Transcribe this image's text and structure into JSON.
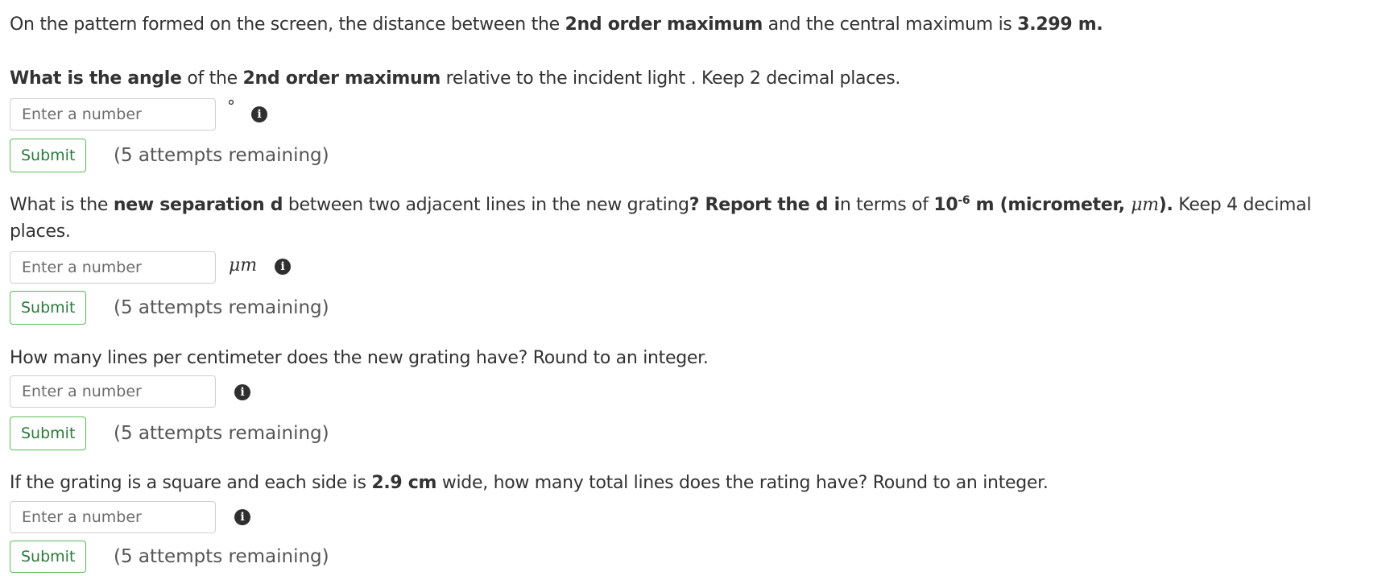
{
  "intro": {
    "t1": "On the pattern formed on the screen, the distance between the ",
    "b1": "2nd order maximum",
    "t2": " and the central maximum is ",
    "b2": "3.299 m."
  },
  "questions": [
    {
      "prompt": {
        "b1": "What is the angle",
        "t1": " of the ",
        "b2": "2nd order maximum",
        "t2": " relative to the incident light . Keep 2 decimal places."
      },
      "input_placeholder": "Enter a number",
      "unit": "°",
      "submit_label": "Submit",
      "attempts": "(5 attempts remaining)"
    },
    {
      "prompt": {
        "t1": "What is the ",
        "b1": "new separation d",
        "t2": " between two adjacent lines in the new grating",
        "b2": "? Report the d i",
        "t3": "n terms of ",
        "b3": "10",
        "sup": "-6",
        "b4": " m (micrometer, ",
        "math": "μm",
        "b5": ").",
        "t4": "  Keep 4 decimal",
        "t5": "places."
      },
      "input_placeholder": "Enter a number",
      "unit": "μm",
      "submit_label": "Submit",
      "attempts": "(5 attempts remaining)"
    },
    {
      "prompt": {
        "t1": "How many lines per centimeter does the new grating have? Round to an integer."
      },
      "input_placeholder": "Enter a number",
      "unit": "",
      "submit_label": "Submit",
      "attempts": "(5 attempts remaining)"
    },
    {
      "prompt": {
        "t1": "If the grating is a square and each side is ",
        "b1": "2.9 cm",
        "t2": " wide, how many total lines does the rating have? Round to an integer."
      },
      "input_placeholder": "Enter a number",
      "unit": "",
      "submit_label": "Submit",
      "attempts": "(5 attempts remaining)"
    }
  ],
  "icons": {
    "info": "info-icon",
    "info_glyph": "i"
  },
  "colors": {
    "submit_border": "#5cb85c",
    "submit_text": "#2b7a3d",
    "info_bg": "#2f2f2f"
  }
}
